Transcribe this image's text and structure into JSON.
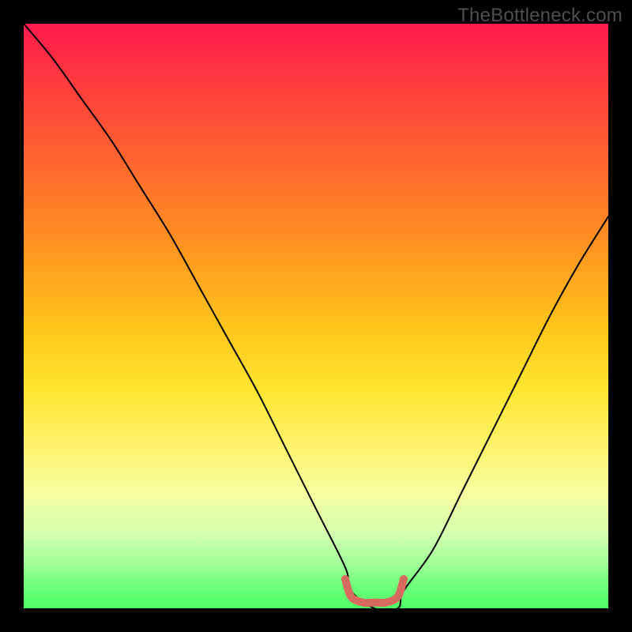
{
  "watermark": "TheBottleneck.com",
  "chart_data": {
    "type": "line",
    "title": "",
    "xlabel": "",
    "ylabel": "",
    "xlim": [
      0,
      100
    ],
    "ylim": [
      0,
      100
    ],
    "series": [
      {
        "name": "bottleneck-curve",
        "x": [
          0,
          5,
          10,
          15,
          20,
          25,
          30,
          35,
          40,
          45,
          50,
          55,
          56,
          60,
          64,
          65,
          70,
          75,
          80,
          85,
          90,
          95,
          100
        ],
        "values": [
          100,
          94,
          87,
          80,
          72,
          64,
          55,
          46,
          37,
          27,
          17,
          7,
          3,
          0,
          0,
          3,
          10,
          20,
          30,
          40,
          50,
          59,
          67
        ]
      },
      {
        "name": "optimal-zone",
        "x": [
          55,
          56,
          58,
          60,
          62,
          64,
          65
        ],
        "values": [
          5,
          2,
          1,
          1,
          1,
          2,
          5
        ]
      }
    ],
    "annotations": [],
    "legend": []
  },
  "colors": {
    "curve": "#000000",
    "optimal_zone": "#d66a5c",
    "gradient_top": "#ff1a4d",
    "gradient_bottom": "#4dff66",
    "frame": "#000000",
    "watermark": "#4f4f4f"
  }
}
